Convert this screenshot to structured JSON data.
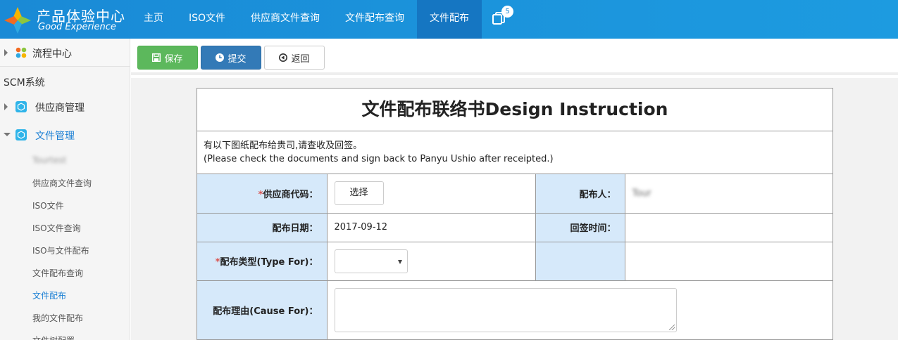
{
  "brand": {
    "name_cn": "产品体验中心",
    "name_en": "Good Experience"
  },
  "nav": {
    "items": [
      {
        "label": "主页"
      },
      {
        "label": "ISO文件"
      },
      {
        "label": "供应商文件查询"
      },
      {
        "label": "文件配布查询"
      },
      {
        "label": "文件配布",
        "active": true
      }
    ],
    "notification_count": "5"
  },
  "sidebar": {
    "flow_center": "流程中心",
    "section": "SCM系统",
    "supplier_mgmt": "供应商管理",
    "file_mgmt": "文件管理",
    "sub_items": [
      {
        "label": "Tourtest",
        "blurred": true
      },
      {
        "label": "供应商文件查询"
      },
      {
        "label": "ISO文件"
      },
      {
        "label": "ISO文件查询"
      },
      {
        "label": "ISO与文件配布"
      },
      {
        "label": "文件配布查询"
      },
      {
        "label": "文件配布",
        "active": true
      },
      {
        "label": "我的文件配布"
      },
      {
        "label": "文件树配置"
      }
    ]
  },
  "toolbar": {
    "save_label": "保存",
    "submit_label": "提交",
    "back_label": "返回"
  },
  "form": {
    "title": "文件配布联络书Design Instruction",
    "notice_line1": "有以下图纸配布给贵司,请查收及回签。",
    "notice_line2": "(Please check the documents and sign back to Panyu Ushio after receipted.)",
    "supplier_code_label": "供应商代码：",
    "select_button": "选择",
    "distributor_label": "配布人：",
    "distributor_value": "Tour",
    "date_label": "配布日期：",
    "date_value": "2017-09-12",
    "reply_time_label": "回签时间：",
    "reply_time_value": "",
    "type_label": "配布类型(Type For)：",
    "type_value": "",
    "reason_label": "配布理由(Cause For)：",
    "reason_value": "",
    "required_mark": "*"
  },
  "colors": {
    "accent": "#1a8ad6",
    "nav_active": "#1576c2",
    "save": "#5cb85c",
    "submit": "#337ab7",
    "label_bg": "#d6e9fa"
  }
}
